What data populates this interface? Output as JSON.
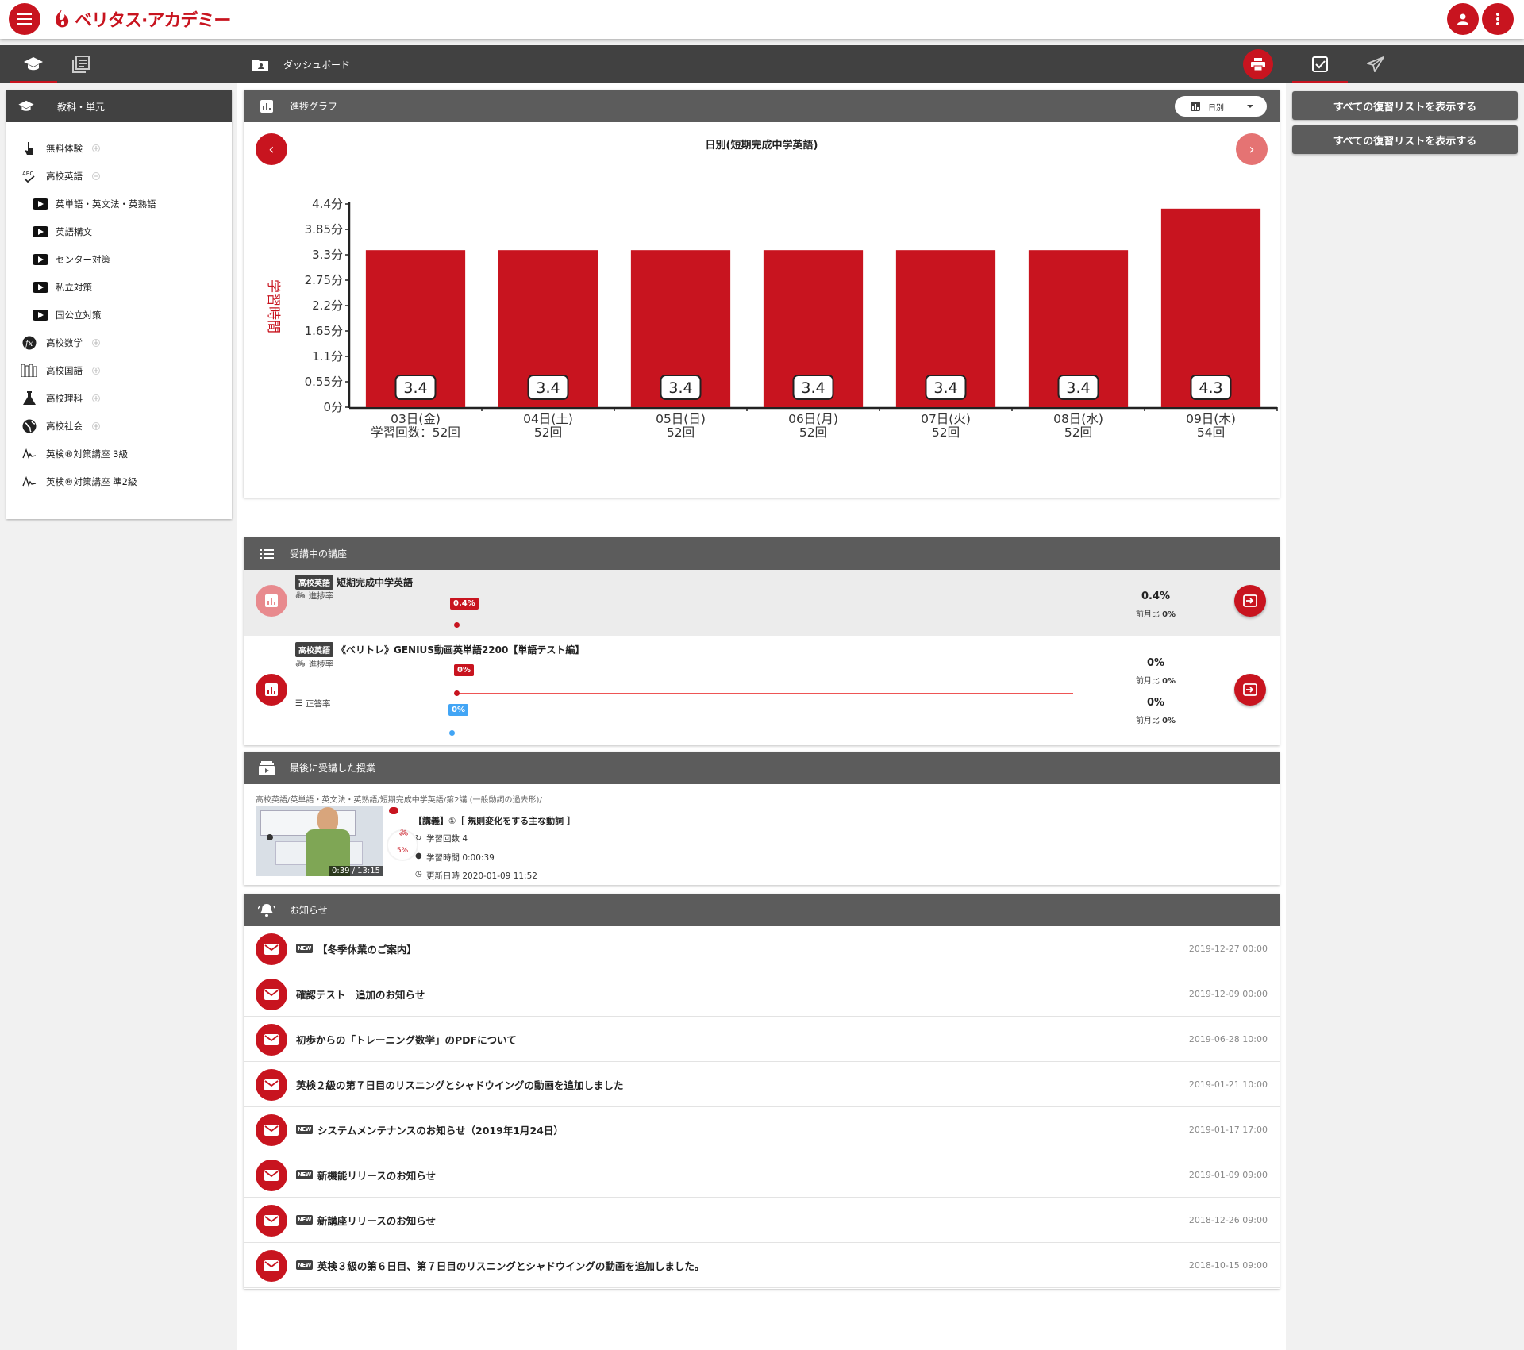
{
  "app": {
    "logo_text": "ベリタス·アカデミー"
  },
  "left": {
    "subject_header": "教科・単元",
    "items": [
      {
        "label": "無料体験",
        "icon": "touch-icon",
        "level": 0,
        "toggle": "plus"
      },
      {
        "label": "高校英語",
        "icon": "abc-check-icon",
        "level": 0,
        "toggle": "minus"
      },
      {
        "label": "英単語・英文法・英熟語",
        "icon": "video-icon",
        "level": 1
      },
      {
        "label": "英語構文",
        "icon": "video-icon",
        "level": 1
      },
      {
        "label": "センター対策",
        "icon": "video-icon",
        "level": 1
      },
      {
        "label": "私立対策",
        "icon": "video-icon",
        "level": 1
      },
      {
        "label": "国公立対策",
        "icon": "video-icon",
        "level": 1
      },
      {
        "label": "高校数学",
        "icon": "function-icon",
        "level": 0,
        "toggle": "plus"
      },
      {
        "label": "高校国語",
        "icon": "books-icon",
        "level": 0,
        "toggle": "plus"
      },
      {
        "label": "高校理科",
        "icon": "flask-icon",
        "level": 0,
        "toggle": "plus"
      },
      {
        "label": "高校社会",
        "icon": "globe-icon",
        "level": 0,
        "toggle": "plus"
      },
      {
        "label": "英検®対策講座 3級",
        "icon": "signature-icon",
        "level": 0
      },
      {
        "label": "英検®対策講座 準2級",
        "icon": "signature-icon",
        "level": 0
      }
    ]
  },
  "center": {
    "dashboard_title": "ダッシュボード",
    "progress": {
      "header": "進捗グラフ",
      "mode_label": "日別",
      "chart_title": "日別(短期完成中学英語)"
    },
    "courses": {
      "header": "受講中の講座",
      "rows": [
        {
          "tag": "高校英語",
          "title": "短期完成中学英語",
          "progress_label": "進捗率",
          "progress_bubble": "0.4%",
          "progress_value": 0.004,
          "progress_pct": "0.4%",
          "progress_prev_label": "前月比",
          "progress_prev": "0%"
        },
        {
          "tag": "高校英語",
          "title": "《ベリトレ》GENIUS動画英単語2200【単語テスト編】",
          "progress_label": "進捗率",
          "progress_bubble": "0%",
          "progress_value": 0,
          "progress_pct": "0%",
          "progress_prev_label": "前月比",
          "progress_prev": "0%",
          "accuracy_label": "正答率",
          "accuracy_bubble": "0%",
          "accuracy_value": 0,
          "accuracy_pct": "0%",
          "accuracy_prev_label": "前月比",
          "accuracy_prev": "0%"
        }
      ]
    },
    "last_lesson": {
      "header": "最後に受講した授業",
      "breadcrumb": "高校英語/英単語・英文法・英熟語/短期完成中学英語/第2講 (一般動詞の過去形)/",
      "title": "【講義】①［ 規則変化をする主な動詞 ］",
      "video_time": "0:39 / 13:15",
      "progress_pct": "5%",
      "study_count": "学習回数 4",
      "study_time": "学習時間 0:00:39",
      "updated": "更新日時 2020-01-09 11:52"
    },
    "notices": {
      "header": "お知らせ",
      "items": [
        {
          "new": true,
          "title": "【冬季休業のご案内】",
          "date": "2019-12-27 00:00"
        },
        {
          "new": false,
          "title": "確認テスト　追加のお知らせ",
          "date": "2019-12-09 00:00"
        },
        {
          "new": false,
          "title": "初歩からの「トレーニング数学」のPDFについて",
          "date": "2019-06-28 10:00"
        },
        {
          "new": false,
          "title": "英検２級の第７日目のリスニングとシャドウイングの動画を追加しました",
          "date": "2019-01-21 10:00"
        },
        {
          "new": true,
          "title": "システムメンテナンスのお知らせ（2019年1月24日）",
          "date": "2019-01-17 17:00"
        },
        {
          "new": true,
          "title": "新機能リリースのお知らせ",
          "date": "2019-01-09 09:00"
        },
        {
          "new": true,
          "title": "新講座リリースのお知らせ",
          "date": "2018-12-26 09:00"
        },
        {
          "new": true,
          "title": "英検３級の第６日目、第７日目のリスニングとシャドウイングの動画を追加しました。",
          "date": "2018-10-15 09:00"
        }
      ],
      "new_badge": "NEW"
    }
  },
  "right": {
    "buttons": [
      "すべての復習リストを表示する",
      "すべての復習リストを表示する"
    ]
  },
  "colors": {
    "brand": "#c8141f",
    "dark": "#414141",
    "header_gray": "#5c5c5c",
    "accuracy_blue": "#42a5f5"
  },
  "chart_data": {
    "type": "bar",
    "title": "日別(短期完成中学英語)",
    "ylabel": "学習時間",
    "categories": [
      "03日(金)",
      "04日(土)",
      "05日(日)",
      "06日(月)",
      "07日(火)",
      "08日(水)",
      "09日(木)"
    ],
    "sublabels": [
      "学習回数：52回",
      "52回",
      "52回",
      "52回",
      "52回",
      "52回",
      "54回"
    ],
    "values": [
      3.4,
      3.4,
      3.4,
      3.4,
      3.4,
      3.4,
      4.3
    ],
    "value_labels": [
      "3.4",
      "3.4",
      "3.4",
      "3.4",
      "3.4",
      "3.4",
      "4.3"
    ],
    "yticks": [
      "0分",
      "0.55分",
      "1.1分",
      "1.65分",
      "2.2分",
      "2.75分",
      "3.3分",
      "3.85分",
      "4.4分"
    ],
    "ylim": [
      0,
      4.4
    ],
    "bar_color": "#c8141f"
  }
}
